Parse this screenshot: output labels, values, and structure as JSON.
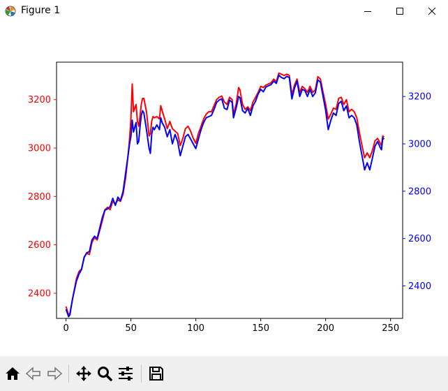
{
  "window": {
    "title": "Figure 1",
    "minimize_icon": "minimize-icon",
    "maximize_icon": "maximize-icon",
    "close_icon": "close-icon"
  },
  "toolbar": {
    "buttons": [
      {
        "name": "home-icon"
      },
      {
        "name": "back-arrow-icon"
      },
      {
        "name": "forward-arrow-icon"
      },
      {
        "name": "pan-icon"
      },
      {
        "name": "zoom-icon"
      },
      {
        "name": "subplots-icon"
      },
      {
        "name": "save-icon"
      }
    ]
  },
  "chart_data": {
    "type": "line",
    "title": "",
    "xlabel": "",
    "ylabel": "",
    "grid": false,
    "x_range": [
      0,
      247
    ],
    "x_ticks": [
      0,
      50,
      100,
      150,
      200,
      250
    ],
    "left_axis": {
      "color": "#ff0000",
      "ylim": [
        2296,
        3355
      ],
      "ticks": [
        2400,
        2600,
        2800,
        3000,
        3200
      ]
    },
    "right_axis": {
      "color": "#0000ff",
      "ylim": [
        2263,
        3345
      ],
      "ticks": [
        2400,
        2600,
        2800,
        3000,
        3200
      ]
    },
    "series": [
      {
        "color": "#ff0000",
        "axis": "left",
        "points": [
          [
            0,
            2345
          ],
          [
            2,
            2310
          ],
          [
            3,
            2318
          ],
          [
            5,
            2375
          ],
          [
            8,
            2460
          ],
          [
            10,
            2490
          ],
          [
            12,
            2500
          ],
          [
            14,
            2550
          ],
          [
            16,
            2565
          ],
          [
            18,
            2560
          ],
          [
            20,
            2610
          ],
          [
            22,
            2630
          ],
          [
            24,
            2620
          ],
          [
            26,
            2660
          ],
          [
            28,
            2700
          ],
          [
            30,
            2745
          ],
          [
            32,
            2755
          ],
          [
            34,
            2745
          ],
          [
            36,
            2780
          ],
          [
            38,
            2770
          ],
          [
            40,
            2785
          ],
          [
            42,
            2780
          ],
          [
            44,
            2810
          ],
          [
            46,
            2880
          ],
          [
            48,
            2980
          ],
          [
            49,
            3040
          ],
          [
            50,
            3120
          ],
          [
            51,
            3265
          ],
          [
            52,
            3150
          ],
          [
            54,
            3180
          ],
          [
            55,
            3110
          ],
          [
            56,
            3090
          ],
          [
            57,
            3130
          ],
          [
            58,
            3180
          ],
          [
            59,
            3205
          ],
          [
            60,
            3205
          ],
          [
            62,
            3150
          ],
          [
            64,
            3050
          ],
          [
            65,
            3060
          ],
          [
            66,
            3110
          ],
          [
            67,
            3130
          ],
          [
            68,
            3125
          ],
          [
            70,
            3130
          ],
          [
            72,
            3120
          ],
          [
            73,
            3175
          ],
          [
            74,
            3155
          ],
          [
            76,
            3120
          ],
          [
            78,
            3080
          ],
          [
            80,
            3110
          ],
          [
            82,
            3080
          ],
          [
            84,
            3070
          ],
          [
            86,
            3060
          ],
          [
            88,
            3010
          ],
          [
            90,
            3040
          ],
          [
            92,
            3080
          ],
          [
            94,
            3090
          ],
          [
            96,
            3070
          ],
          [
            98,
            3040
          ],
          [
            100,
            3020
          ],
          [
            102,
            3060
          ],
          [
            104,
            3090
          ],
          [
            106,
            3120
          ],
          [
            108,
            3140
          ],
          [
            110,
            3150
          ],
          [
            112,
            3150
          ],
          [
            114,
            3175
          ],
          [
            116,
            3200
          ],
          [
            118,
            3210
          ],
          [
            120,
            3215
          ],
          [
            122,
            3190
          ],
          [
            124,
            3180
          ],
          [
            126,
            3210
          ],
          [
            128,
            3200
          ],
          [
            129,
            3140
          ],
          [
            131,
            3180
          ],
          [
            133,
            3250
          ],
          [
            134,
            3240
          ],
          [
            136,
            3180
          ],
          [
            138,
            3160
          ],
          [
            140,
            3170
          ],
          [
            142,
            3155
          ],
          [
            144,
            3190
          ],
          [
            146,
            3210
          ],
          [
            148,
            3230
          ],
          [
            150,
            3255
          ],
          [
            152,
            3250
          ],
          [
            154,
            3260
          ],
          [
            156,
            3265
          ],
          [
            158,
            3270
          ],
          [
            160,
            3285
          ],
          [
            162,
            3275
          ],
          [
            164,
            3310
          ],
          [
            166,
            3305
          ],
          [
            168,
            3300
          ],
          [
            170,
            3305
          ],
          [
            172,
            3300
          ],
          [
            174,
            3220
          ],
          [
            176,
            3260
          ],
          [
            178,
            3285
          ],
          [
            180,
            3230
          ],
          [
            182,
            3255
          ],
          [
            184,
            3245
          ],
          [
            186,
            3230
          ],
          [
            188,
            3255
          ],
          [
            190,
            3230
          ],
          [
            192,
            3240
          ],
          [
            194,
            3295
          ],
          [
            196,
            3285
          ],
          [
            198,
            3230
          ],
          [
            200,
            3180
          ],
          [
            202,
            3120
          ],
          [
            204,
            3140
          ],
          [
            206,
            3165
          ],
          [
            208,
            3160
          ],
          [
            210,
            3205
          ],
          [
            212,
            3210
          ],
          [
            214,
            3180
          ],
          [
            216,
            3200
          ],
          [
            218,
            3150
          ],
          [
            220,
            3160
          ],
          [
            222,
            3150
          ],
          [
            224,
            3125
          ],
          [
            226,
            3065
          ],
          [
            228,
            3010
          ],
          [
            230,
            2960
          ],
          [
            232,
            2980
          ],
          [
            234,
            2960
          ],
          [
            236,
            2990
          ],
          [
            238,
            3030
          ],
          [
            240,
            3040
          ],
          [
            242,
            3020
          ],
          [
            243,
            3010
          ],
          [
            244,
            3050
          ],
          [
            245,
            3045
          ]
        ]
      },
      {
        "color": "#0000ff",
        "axis": "right",
        "points": [
          [
            0,
            2302
          ],
          [
            2,
            2270
          ],
          [
            3,
            2278
          ],
          [
            5,
            2345
          ],
          [
            8,
            2420
          ],
          [
            10,
            2450
          ],
          [
            12,
            2470
          ],
          [
            14,
            2520
          ],
          [
            16,
            2540
          ],
          [
            18,
            2545
          ],
          [
            20,
            2595
          ],
          [
            22,
            2610
          ],
          [
            24,
            2600
          ],
          [
            26,
            2645
          ],
          [
            28,
            2690
          ],
          [
            30,
            2720
          ],
          [
            32,
            2725
          ],
          [
            34,
            2735
          ],
          [
            36,
            2770
          ],
          [
            38,
            2740
          ],
          [
            40,
            2775
          ],
          [
            42,
            2760
          ],
          [
            44,
            2800
          ],
          [
            46,
            2880
          ],
          [
            48,
            2960
          ],
          [
            49,
            3000
          ],
          [
            50,
            3030
          ],
          [
            51,
            3100
          ],
          [
            52,
            3050
          ],
          [
            54,
            3090
          ],
          [
            55,
            3000
          ],
          [
            56,
            3010
          ],
          [
            57,
            3070
          ],
          [
            58,
            3120
          ],
          [
            59,
            3140
          ],
          [
            60,
            3130
          ],
          [
            62,
            3060
          ],
          [
            64,
            2980
          ],
          [
            65,
            2960
          ],
          [
            66,
            3040
          ],
          [
            67,
            3070
          ],
          [
            68,
            3060
          ],
          [
            70,
            3080
          ],
          [
            72,
            3060
          ],
          [
            73,
            3110
          ],
          [
            74,
            3090
          ],
          [
            76,
            3070
          ],
          [
            78,
            3030
          ],
          [
            80,
            3060
          ],
          [
            82,
            3000
          ],
          [
            84,
            3040
          ],
          [
            86,
            3010
          ],
          [
            88,
            2950
          ],
          [
            90,
            2990
          ],
          [
            92,
            3030
          ],
          [
            94,
            3040
          ],
          [
            96,
            3020
          ],
          [
            98,
            3000
          ],
          [
            100,
            2980
          ],
          [
            102,
            3020
          ],
          [
            104,
            3060
          ],
          [
            106,
            3090
          ],
          [
            108,
            3110
          ],
          [
            110,
            3115
          ],
          [
            112,
            3120
          ],
          [
            114,
            3145
          ],
          [
            116,
            3175
          ],
          [
            118,
            3185
          ],
          [
            120,
            3190
          ],
          [
            122,
            3150
          ],
          [
            124,
            3145
          ],
          [
            126,
            3185
          ],
          [
            128,
            3175
          ],
          [
            129,
            3110
          ],
          [
            131,
            3150
          ],
          [
            133,
            3200
          ],
          [
            134,
            3195
          ],
          [
            136,
            3140
          ],
          [
            138,
            3130
          ],
          [
            140,
            3150
          ],
          [
            142,
            3120
          ],
          [
            144,
            3160
          ],
          [
            146,
            3180
          ],
          [
            148,
            3210
          ],
          [
            150,
            3230
          ],
          [
            152,
            3220
          ],
          [
            154,
            3240
          ],
          [
            156,
            3245
          ],
          [
            158,
            3250
          ],
          [
            160,
            3265
          ],
          [
            162,
            3255
          ],
          [
            164,
            3290
          ],
          [
            166,
            3280
          ],
          [
            168,
            3275
          ],
          [
            170,
            3285
          ],
          [
            172,
            3280
          ],
          [
            174,
            3190
          ],
          [
            176,
            3235
          ],
          [
            178,
            3265
          ],
          [
            180,
            3200
          ],
          [
            182,
            3230
          ],
          [
            184,
            3225
          ],
          [
            186,
            3200
          ],
          [
            188,
            3230
          ],
          [
            190,
            3200
          ],
          [
            192,
            3215
          ],
          [
            194,
            3270
          ],
          [
            196,
            3260
          ],
          [
            198,
            3200
          ],
          [
            200,
            3140
          ],
          [
            202,
            3060
          ],
          [
            204,
            3100
          ],
          [
            206,
            3130
          ],
          [
            208,
            3120
          ],
          [
            210,
            3170
          ],
          [
            212,
            3180
          ],
          [
            214,
            3140
          ],
          [
            216,
            3160
          ],
          [
            218,
            3110
          ],
          [
            220,
            3120
          ],
          [
            222,
            3110
          ],
          [
            224,
            3080
          ],
          [
            226,
            3010
          ],
          [
            228,
            2950
          ],
          [
            230,
            2890
          ],
          [
            232,
            2920
          ],
          [
            234,
            2890
          ],
          [
            236,
            2940
          ],
          [
            238,
            2990
          ],
          [
            240,
            3010
          ],
          [
            242,
            2985
          ],
          [
            243,
            2975
          ],
          [
            244,
            3025
          ],
          [
            245,
            3020
          ]
        ]
      }
    ]
  }
}
